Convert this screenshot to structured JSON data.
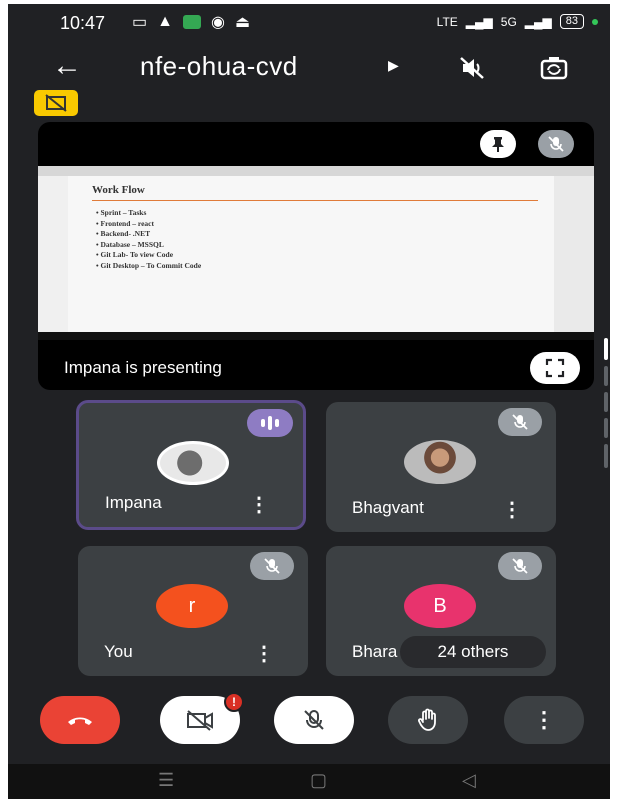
{
  "status": {
    "time": "10:47",
    "network": "LTE",
    "signal": "5G",
    "battery": "83"
  },
  "header": {
    "title": "nfe-ohua-cvd"
  },
  "presentation": {
    "slide_title": "Work Flow",
    "slide_items": [
      "Sprint – Tasks",
      "Frontend – react",
      "Backend- .NET",
      "Database – MSSQL",
      "Git Lab- To view Code",
      "Git Desktop – To Commit Code"
    ],
    "presenting_label": "Impana is presenting"
  },
  "participants": [
    {
      "name": "Impana",
      "avatar": "photo"
    },
    {
      "name": "Bhagvant",
      "avatar": "photo"
    },
    {
      "name": "You",
      "avatar_letter": "r",
      "avatar_color": "#f4511e"
    },
    {
      "name": "Bhara",
      "avatar_letter": "B",
      "avatar_color": "#e8336d"
    }
  ],
  "others_label": "24 others",
  "notification_badge": "!",
  "colors": {
    "background": "#202124",
    "tile": "#3c4043",
    "end_call": "#ea4335",
    "speaking": "#8e7cc3",
    "presentation_badge": "#f9c900"
  },
  "icons": {
    "back": "arrow-left-icon",
    "audio_off": "speaker-off-icon",
    "switch_camera": "switch-camera-icon",
    "pin": "pin-icon",
    "mic_off": "mic-off-icon",
    "expand": "fullscreen-icon",
    "end_call": "phone-hangup-icon",
    "camera_off": "camera-off-icon",
    "hand": "raise-hand-icon",
    "more": "more-vertical-icon"
  }
}
